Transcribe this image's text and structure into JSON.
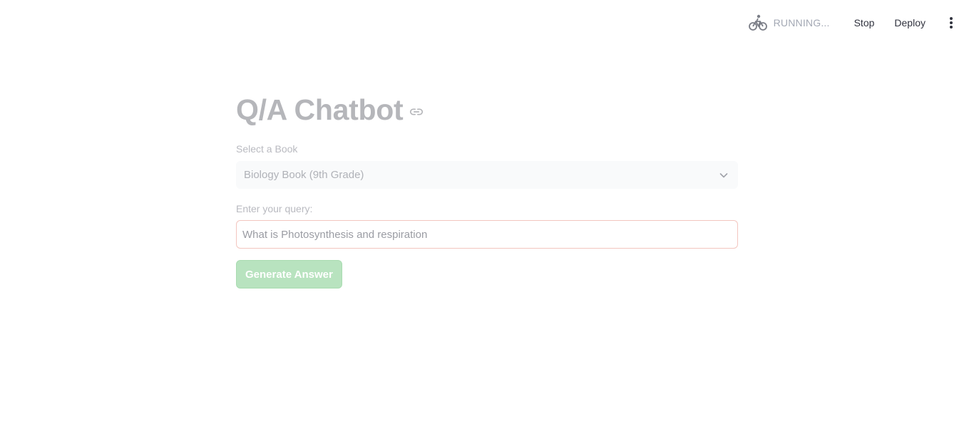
{
  "toolbar": {
    "status_icon": "bicycle-icon",
    "status_text": "RUNNING...",
    "stop_label": "Stop",
    "deploy_label": "Deploy",
    "menu_icon": "vertical-ellipsis-icon"
  },
  "main": {
    "title": "Q/A Chatbot",
    "title_anchor_icon": "link-icon",
    "book_select": {
      "label": "Select a Book",
      "selected": "Biology Book (9th Grade)",
      "chevron_icon": "chevron-down-icon"
    },
    "query": {
      "label": "Enter your query:",
      "value": "What is Photosynthesis and respiration"
    },
    "generate_label": "Generate Answer"
  },
  "colors": {
    "title": "#b5b6ba",
    "button_bg": "#b8e3bf",
    "input_border": "#f3c6bf",
    "select_bg": "#f9fafb"
  }
}
